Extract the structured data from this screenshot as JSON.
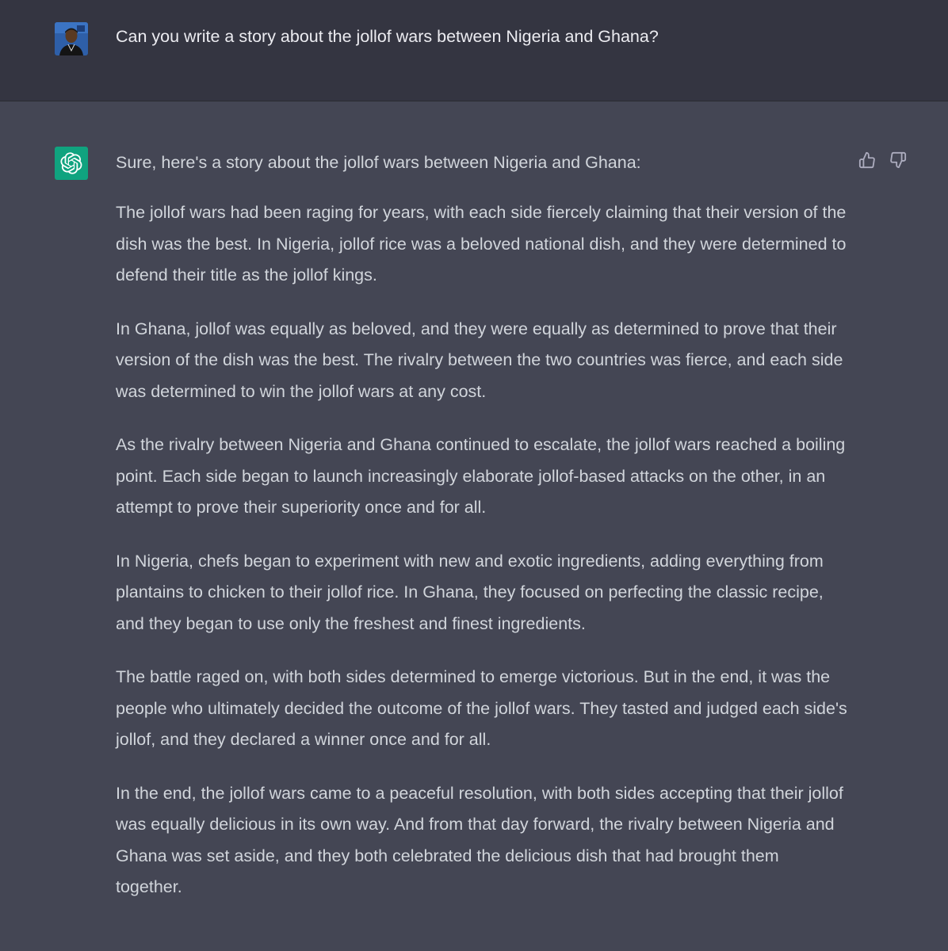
{
  "user_message": {
    "text": "Can you write a story about the jollof wars between Nigeria and Ghana?",
    "avatar_icon": "user-avatar-photo"
  },
  "assistant_message": {
    "avatar_icon": "openai-logo-icon",
    "avatar_color": "#10a37f",
    "intro": "Sure, here's a story about the jollof wars between Nigeria and Ghana:",
    "paragraphs": [
      "The jollof wars had been raging for years, with each side fiercely claiming that their version of the dish was the best. In Nigeria, jollof rice was a beloved national dish, and they were determined to defend their title as the jollof kings.",
      "In Ghana, jollof was equally as beloved, and they were equally as determined to prove that their version of the dish was the best. The rivalry between the two countries was fierce, and each side was determined to win the jollof wars at any cost.",
      "As the rivalry between Nigeria and Ghana continued to escalate, the jollof wars reached a boiling point. Each side began to launch increasingly elaborate jollof-based attacks on the other, in an attempt to prove their superiority once and for all.",
      "In Nigeria, chefs began to experiment with new and exotic ingredients, adding everything from plantains to chicken to their jollof rice. In Ghana, they focused on perfecting the classic recipe, and they began to use only the freshest and finest ingredients.",
      "The battle raged on, with both sides determined to emerge victorious. But in the end, it was the people who ultimately decided the outcome of the jollof wars. They tasted and judged each side's jollof, and they declared a winner once and for all.",
      "In the end, the jollof wars came to a peaceful resolution, with both sides accepting that their jollof was equally delicious in its own way. And from that day forward, the rivalry between Nigeria and Ghana was set aside, and they both celebrated the delicious dish that had brought them together."
    ]
  },
  "feedback": {
    "thumbs_up_icon": "thumbs-up-icon",
    "thumbs_down_icon": "thumbs-down-icon"
  },
  "colors": {
    "user_bg": "#343541",
    "assistant_bg": "#444654",
    "user_text": "#ececf1",
    "assistant_text": "#d1d5db"
  }
}
